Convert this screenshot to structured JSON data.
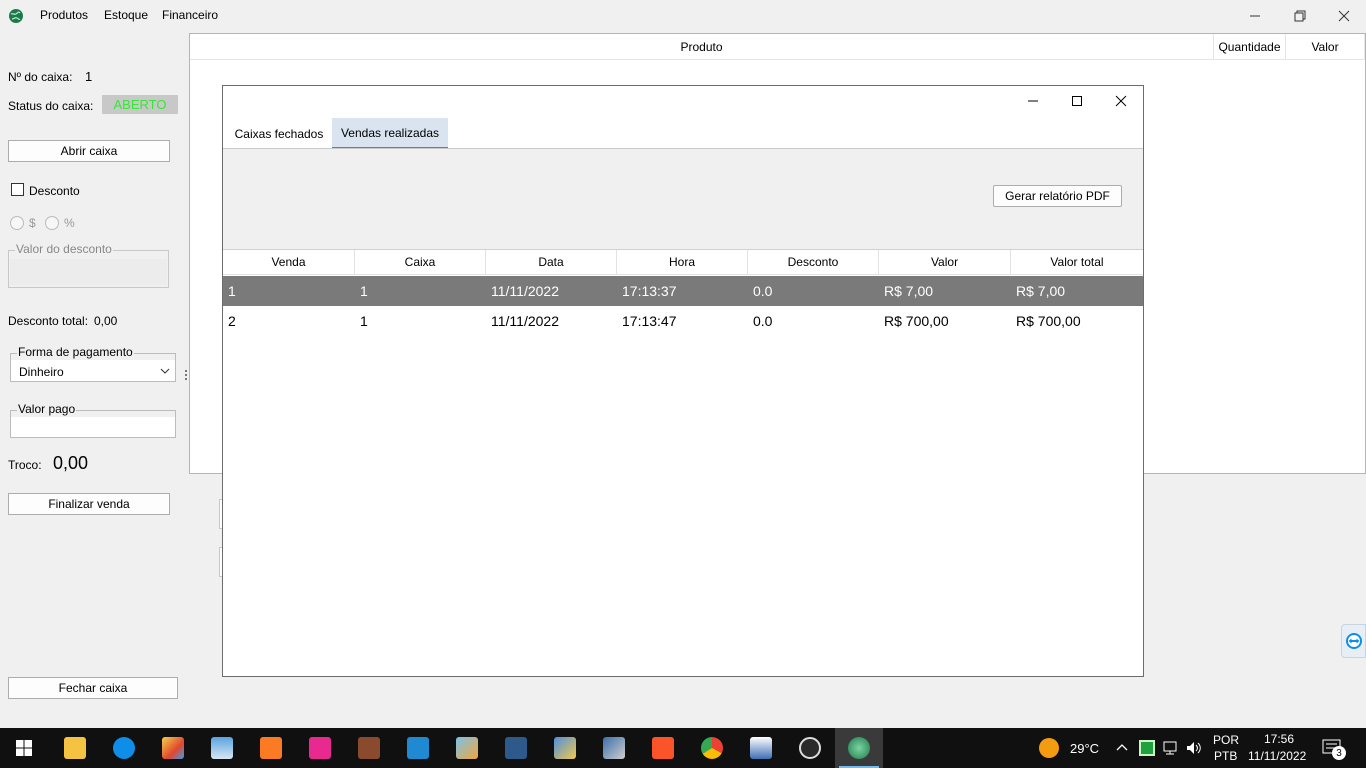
{
  "menu": {
    "items": [
      "Produtos",
      "Estoque",
      "Financeiro"
    ]
  },
  "left": {
    "caixa_num_label": "Nº do caixa:",
    "caixa_num_value": "1",
    "status_label": "Status do caixa:",
    "status_value": "ABERTO",
    "abrir_caixa": "Abrir caixa",
    "desconto_label": "Desconto",
    "radio_currency": "$",
    "radio_percent": "%",
    "valor_desconto_legend": "Valor do desconto",
    "desconto_total_label": "Desconto total:",
    "desconto_total_value": "0,00",
    "forma_pagamento_legend": "Forma de pagamento",
    "forma_pagamento_value": "Dinheiro",
    "valor_pago_legend": "Valor pago",
    "troco_label": "Troco:",
    "troco_value": "0,00",
    "finalizar_venda": "Finalizar venda",
    "fechar_caixa": "Fechar caixa"
  },
  "bg_table": {
    "columns": [
      "Produto",
      "Quantidade",
      "Valor"
    ]
  },
  "dialog": {
    "tabs": [
      "Caixas fechados",
      "Vendas realizadas"
    ],
    "active_tab": "Vendas realizadas",
    "pdf_button": "Gerar relatório PDF",
    "columns": [
      "Venda",
      "Caixa",
      "Data",
      "Hora",
      "Desconto",
      "Valor",
      "Valor total"
    ],
    "rows": [
      [
        "1",
        "1",
        "11/11/2022",
        "17:13:37",
        "0.0",
        "R$ 7,00",
        "R$ 7,00"
      ],
      [
        "2",
        "1",
        "11/11/2022",
        "17:13:47",
        "0.0",
        "R$ 700,00",
        "R$ 700,00"
      ]
    ]
  },
  "taskbar": {
    "apps": [
      "start-icon",
      "file-explorer-icon",
      "teamviewer-icon",
      "paint-icon",
      "notepad-icon",
      "xampp-icon",
      "uwamp-icon",
      "winrar-icon",
      "vscode-icon",
      "netbeans-icon",
      "mysql-workbench-icon",
      "network-icon",
      "lock-app-icon",
      "brave-icon",
      "chrome-icon",
      "screen-app-icon",
      "obs-icon",
      "java-app-icon"
    ],
    "weather": "29°C",
    "lang1": "POR",
    "lang2": "PTB",
    "time": "17:56",
    "date": "11/11/2022",
    "notifications": "3"
  },
  "colors": {
    "status_green": "#35e835",
    "selected_row": "#7a7a7a",
    "active_tab": "#d9e4f0",
    "accent": "#4d86c7"
  }
}
